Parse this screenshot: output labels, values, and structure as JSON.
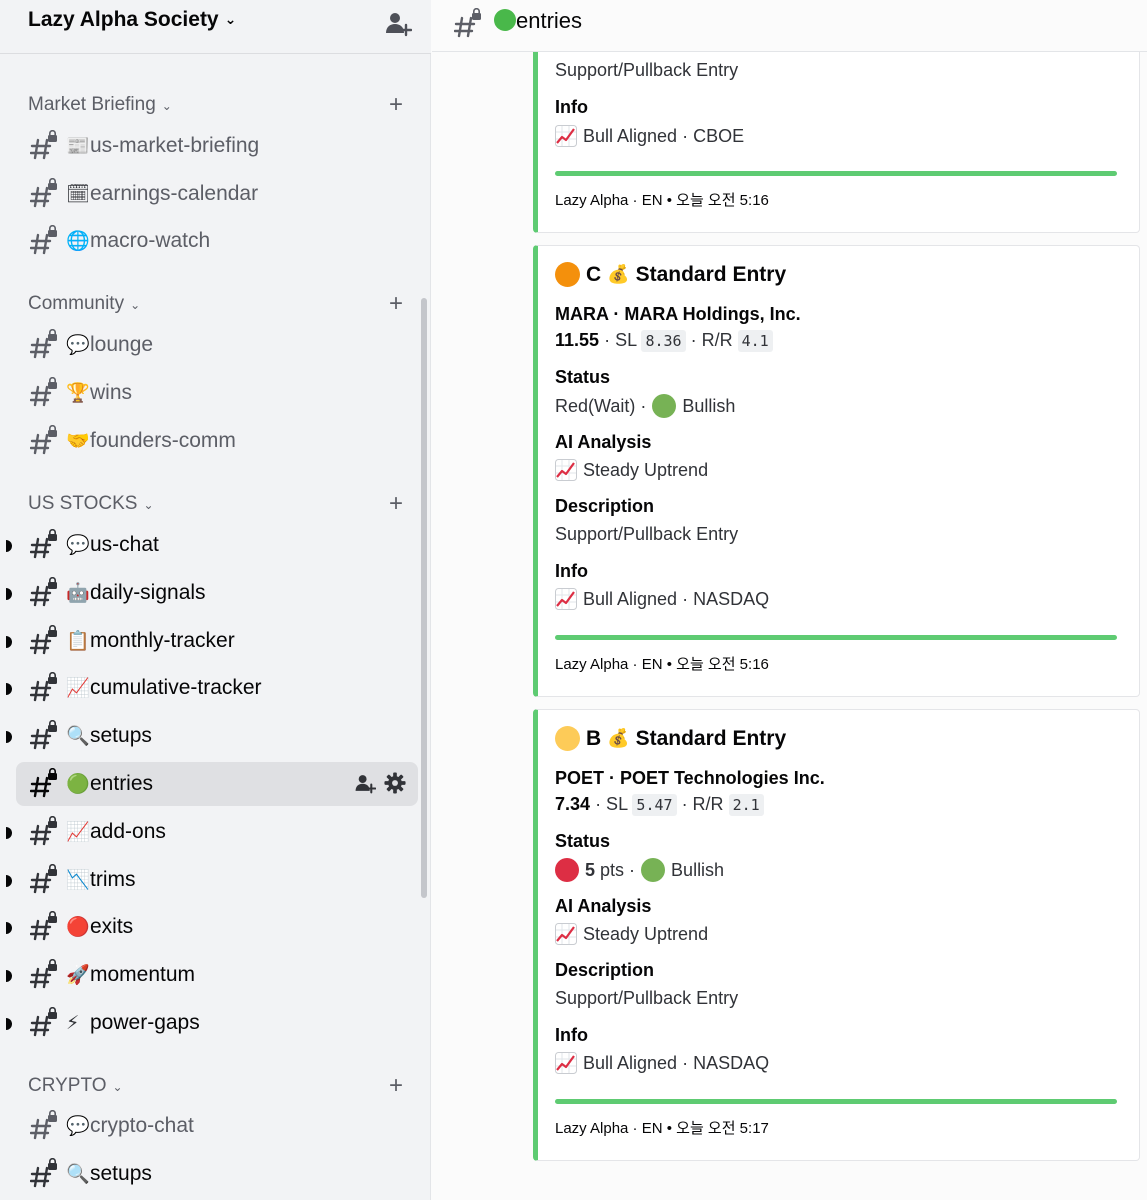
{
  "server": {
    "name": "Lazy Alpha Society"
  },
  "categories": [
    {
      "label": "Market Briefing"
    },
    {
      "label": "Community"
    },
    {
      "label": "US STOCKS"
    },
    {
      "label": "CRYPTO"
    }
  ],
  "channels": [
    {
      "emoji": "📰",
      "name": "us-market-briefing"
    },
    {
      "emoji": "🗓",
      "name": "earnings-calendar"
    },
    {
      "emoji": "🌐",
      "name": "macro-watch"
    },
    {
      "emoji": "💬",
      "name": "lounge"
    },
    {
      "emoji": "🏆",
      "name": "wins"
    },
    {
      "emoji": "🤝",
      "name": "founders-comm"
    },
    {
      "emoji": "💬",
      "name": "us-chat"
    },
    {
      "emoji": "🤖",
      "name": "daily-signals"
    },
    {
      "emoji": "📋",
      "name": "monthly-tracker"
    },
    {
      "emoji": "📈",
      "name": "cumulative-tracker"
    },
    {
      "emoji": "🔍",
      "name": "setups"
    },
    {
      "emoji": "🟢",
      "name": "entries"
    },
    {
      "emoji": "📈",
      "name": "add-ons"
    },
    {
      "emoji": "📉",
      "name": "trims"
    },
    {
      "emoji": "🔴",
      "name": "exits"
    },
    {
      "emoji": "🚀",
      "name": "momentum"
    },
    {
      "emoji": "⚡",
      "name": "power-gaps"
    },
    {
      "emoji": "💬",
      "name": "crypto-chat"
    },
    {
      "emoji": "🔍",
      "name": "setups"
    }
  ],
  "topbar": {
    "channel": "entries"
  },
  "embeds": [
    {
      "desc_value": "Support/Pullback Entry",
      "info_label": "Info",
      "info_value": "Bull Aligned · CBOE",
      "footer": "Lazy Alpha · EN • 오늘 오전 5:16"
    },
    {
      "grade": "C",
      "title": "Standard Entry",
      "ticker": "MARA · MARA Holdings, Inc.",
      "price": "11.55",
      "sl_label": "· SL",
      "sl": "8.36",
      "rr_label": "· R/R",
      "rr": "4.1",
      "status_label": "Status",
      "status_text": "Red(Wait) ·",
      "status_trend": "Bullish",
      "ai_label": "AI Analysis",
      "ai_value": "Steady Uptrend",
      "desc_label": "Description",
      "desc_value": "Support/Pullback Entry",
      "info_label": "Info",
      "info_value": "Bull Aligned · NASDAQ",
      "footer": "Lazy Alpha · EN • 오늘 오전 5:16"
    },
    {
      "grade": "B",
      "title": "Standard Entry",
      "ticker": "POET · POET Technologies Inc.",
      "price": "7.34",
      "sl_label": "· SL",
      "sl": "5.47",
      "rr_label": "· R/R",
      "rr": "2.1",
      "status_label": "Status",
      "status_pts": "5",
      "status_pts_unit": "pts ·",
      "status_trend": "Bullish",
      "ai_label": "AI Analysis",
      "ai_value": "Steady Uptrend",
      "desc_label": "Description",
      "desc_value": "Support/Pullback Entry",
      "info_label": "Info",
      "info_value": "Bull Aligned · NASDAQ",
      "footer": "Lazy Alpha · EN • 오늘 오전 5:17"
    }
  ],
  "colors": {
    "accent_green": "#5ecb72",
    "active_bg": "#dfe0e3",
    "sidebar_bg": "#f2f3f5"
  }
}
